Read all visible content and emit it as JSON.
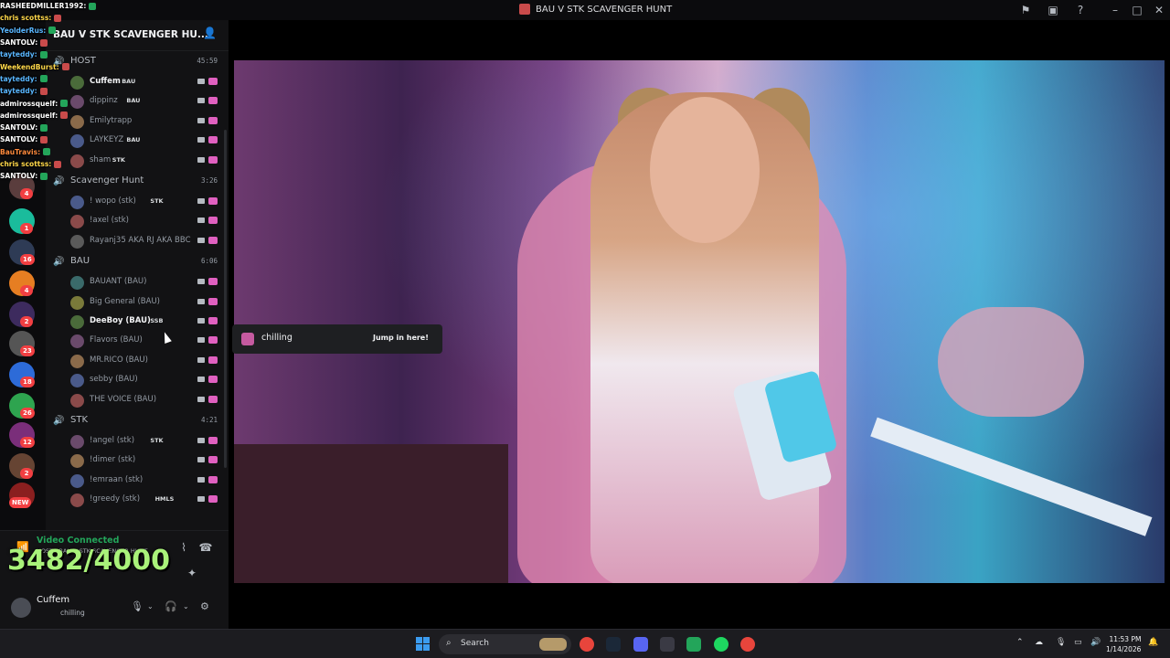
{
  "window": {
    "title": "BAU V STK SCAVENGER HUNT"
  },
  "chat_overlay": [
    {
      "user": "RASHEEDMILLER1992:",
      "color": "#ffffff"
    },
    {
      "user": "chris scottss:",
      "color": "#ffd84a"
    },
    {
      "user": "YeolderRus:",
      "color": "#59b6ff"
    },
    {
      "user": "SANTOLV:",
      "color": "#ffffff"
    },
    {
      "user": "tayteddy:",
      "color": "#59b6ff"
    },
    {
      "user": "WeekendBurst:",
      "color": "#ffd84a"
    },
    {
      "user": "tayteddy:",
      "color": "#59b6ff"
    },
    {
      "user": "tayteddy:",
      "color": "#59b6ff"
    },
    {
      "user": "admirossquelf:",
      "color": "#ffffff"
    },
    {
      "user": "admirossquelf:",
      "color": "#ffffff"
    },
    {
      "user": "SANTOLV:",
      "color": "#ffffff"
    },
    {
      "user": "SANTOLV:",
      "color": "#ffffff"
    },
    {
      "user": "BauTravis:",
      "color": "#ff8a3d"
    },
    {
      "user": "chris scottss:",
      "color": "#ffd84a"
    },
    {
      "user": "SANTOLV:",
      "color": "#ffffff"
    }
  ],
  "server": {
    "name": "BAU V STK SCAVENGER HU..."
  },
  "rail_badges": [
    "4",
    "1",
    "16",
    "4",
    "2",
    "23",
    "18",
    "26",
    "12",
    "2",
    "NEW"
  ],
  "channels": [
    {
      "name": "HOST",
      "time": "45:59",
      "users": [
        {
          "name": "Cuffem",
          "tag": "BAU",
          "bright": true
        },
        {
          "name": "dippinz",
          "tag": "BAU"
        },
        {
          "name": "Emilytrapp",
          "tag": ""
        },
        {
          "name": "LAYKEYZ",
          "tag": "BAU"
        },
        {
          "name": "sham",
          "tag": "STK"
        }
      ]
    },
    {
      "name": "Scavenger Hunt",
      "time": "3:26",
      "users": [
        {
          "name": "! wopo (stk)",
          "tag": "STK"
        },
        {
          "name": "!axel (stk)",
          "tag": ""
        },
        {
          "name": "Rayanj35 AKA RJ AKA BBC",
          "tag": ""
        }
      ]
    },
    {
      "name": "BAU",
      "time": "6:06",
      "users": [
        {
          "name": "BAUANT (BAU)",
          "tag": ""
        },
        {
          "name": "Big General (BAU)",
          "tag": ""
        },
        {
          "name": "DeeBoy (BAU)",
          "tag": "SSB",
          "bright": true
        },
        {
          "name": "Flavors (BAU)",
          "tag": ""
        },
        {
          "name": "MR.RICO (BAU)",
          "tag": ""
        },
        {
          "name": "sebby (BAU)",
          "tag": ""
        },
        {
          "name": "THE VOICE (BAU)",
          "tag": ""
        }
      ]
    },
    {
      "name": "STK",
      "time": "4:21",
      "users": [
        {
          "name": "!angel (stk)",
          "tag": "STK"
        },
        {
          "name": "!dimer (stk)",
          "tag": ""
        },
        {
          "name": "!emraan (stk)",
          "tag": ""
        },
        {
          "name": "!greedy (stk)",
          "tag": "HMLS"
        }
      ]
    }
  ],
  "counter": "3482/4000",
  "voice": {
    "status": "Video Connected",
    "channel": "HOST / BAU V STK SCAVENGER HUNT"
  },
  "me": {
    "name": "Cuffem",
    "status": "chilling"
  },
  "popup": {
    "text": "chilling",
    "button": "Jump in here!"
  },
  "taskbar": {
    "search": "Search",
    "time": "11:53 PM",
    "date": "1/14/2026"
  },
  "colors": {
    "accent_green": "#23a55a",
    "counter": "#a9f27a"
  }
}
